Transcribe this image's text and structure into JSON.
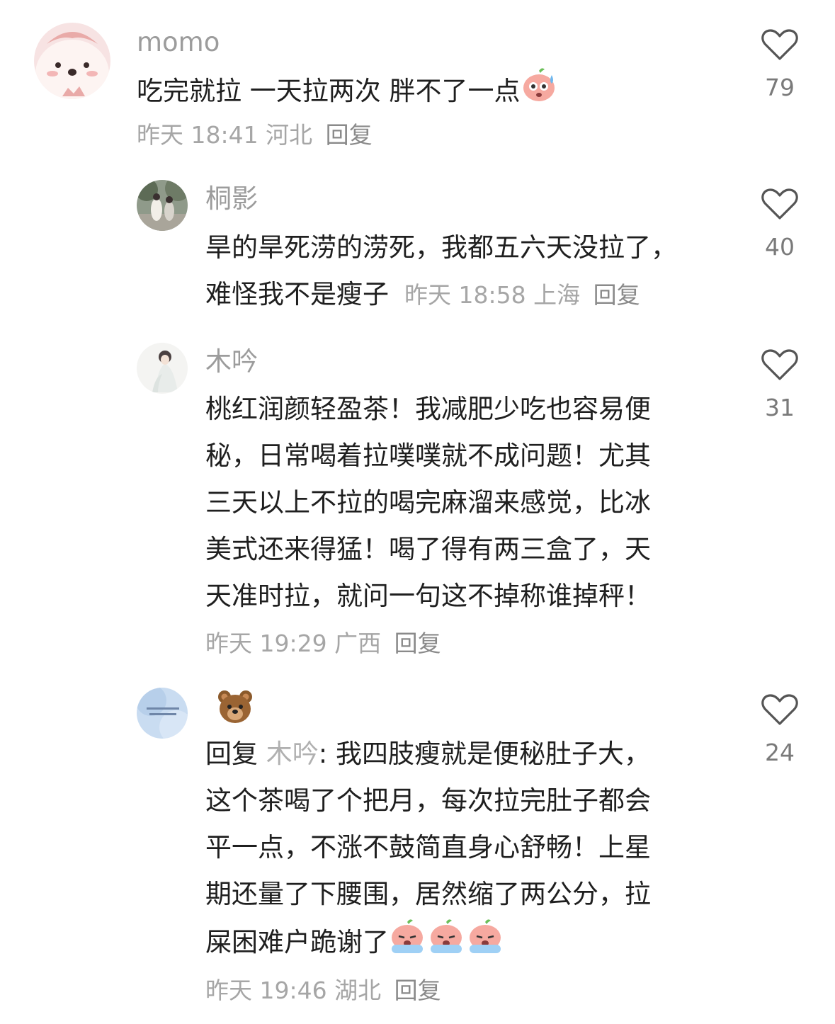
{
  "comments": [
    {
      "username": "momo",
      "lines": [
        "吃完就拉 一天拉两次 胖不了一点"
      ],
      "time": "昨天 18:41",
      "location": "河北",
      "reply_label": "回复",
      "likes": "79",
      "emoji": "sweat-peach-emoji"
    },
    {
      "username": "桐影",
      "lines": [
        "旱的旱死涝的涝死，我都五六天没拉了，",
        "难怪我不是瘦子"
      ],
      "time": "昨天 18:58",
      "location": "上海",
      "reply_label": "回复",
      "likes": "40"
    },
    {
      "username": "木吟",
      "lines": [
        "桃红润颜轻盈茶！我减肥少吃也容易便",
        "秘，日常喝着拉噗噗就不成问题！尤其",
        "三天以上不拉的喝完麻溜来感觉，比冰",
        "美式还来得猛！喝了得有两三盒了，天",
        "天准时拉，就问一句这不掉称谁掉秤！"
      ],
      "time": "昨天 19:29",
      "location": "广西",
      "reply_label": "回复",
      "likes": "31"
    },
    {
      "username_emoji": "bear-emoji",
      "reply_prefix": "回复",
      "reply_to": "木吟",
      "first_line_rest": ": 我四肢瘦就是便秘肚子大，",
      "lines": [
        "这个茶喝了个把月，每次拉完肚子都会",
        "平一点，不涨不鼓简直身心舒畅！上星",
        "期还量了下腰围，居然缩了两公分，拉",
        "屎困难户跪谢了"
      ],
      "time": "昨天 19:46",
      "location": "湖北",
      "reply_label": "回复",
      "likes": "24",
      "emoji": "crying-peach-emoji"
    }
  ]
}
